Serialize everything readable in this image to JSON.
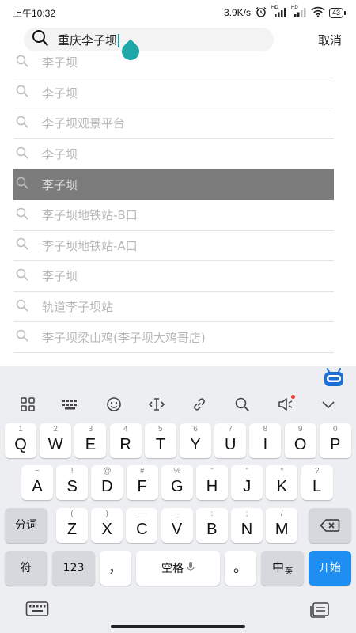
{
  "status_bar": {
    "time": "上午10:32",
    "speed": "3.9K/s",
    "signal1_label": "HD",
    "signal2_label": "HD",
    "battery": "43"
  },
  "search": {
    "query": "重庆李子坝",
    "cancel_label": "取消"
  },
  "suggestions": [
    {
      "label": "李子坝"
    },
    {
      "label": "李子坝"
    },
    {
      "label": "李子坝观景平台"
    },
    {
      "label": "李子坝"
    },
    {
      "label": "李子坝",
      "active": true
    },
    {
      "label": "李子坝地铁站-B口"
    },
    {
      "label": "李子坝地铁站-A口"
    },
    {
      "label": "李子坝"
    },
    {
      "label": "轨道李子坝站"
    },
    {
      "label": "李子坝梁山鸡(李子坝大鸡哥店)"
    }
  ],
  "keyboard": {
    "toolbar": [
      "grid-icon",
      "keyboard-layout-icon",
      "emoji-icon",
      "cursor-move-icon",
      "link-icon",
      "search-icon",
      "speaker-icon",
      "collapse-icon"
    ],
    "row1": [
      {
        "main": "Q",
        "sub": "1"
      },
      {
        "main": "W",
        "sub": "2"
      },
      {
        "main": "E",
        "sub": "3"
      },
      {
        "main": "R",
        "sub": "4"
      },
      {
        "main": "T",
        "sub": "5"
      },
      {
        "main": "Y",
        "sub": "6"
      },
      {
        "main": "U",
        "sub": "7"
      },
      {
        "main": "I",
        "sub": "8"
      },
      {
        "main": "O",
        "sub": "9"
      },
      {
        "main": "P",
        "sub": "0"
      }
    ],
    "row2": [
      {
        "main": "A",
        "sub": "~"
      },
      {
        "main": "S",
        "sub": "!"
      },
      {
        "main": "D",
        "sub": "@"
      },
      {
        "main": "F",
        "sub": "#"
      },
      {
        "main": "G",
        "sub": "%"
      },
      {
        "main": "H",
        "sub": "\""
      },
      {
        "main": "J",
        "sub": "\""
      },
      {
        "main": "K",
        "sub": "*"
      },
      {
        "main": "L",
        "sub": "?"
      }
    ],
    "row3": [
      {
        "main": "Z",
        "sub": "("
      },
      {
        "main": "X",
        "sub": ")"
      },
      {
        "main": "C",
        "sub": "—"
      },
      {
        "main": "V",
        "sub": "_"
      },
      {
        "main": "B",
        "sub": ":"
      },
      {
        "main": "N",
        "sub": ";"
      },
      {
        "main": "M",
        "sub": "/"
      }
    ],
    "segment_label": "分词",
    "symbol_label": "符",
    "num_label": "123",
    "comma_label": "，",
    "space_label": "空格",
    "period_label": "。",
    "zh_label": "中",
    "en_small_label": "英",
    "enter_label": "开始"
  }
}
